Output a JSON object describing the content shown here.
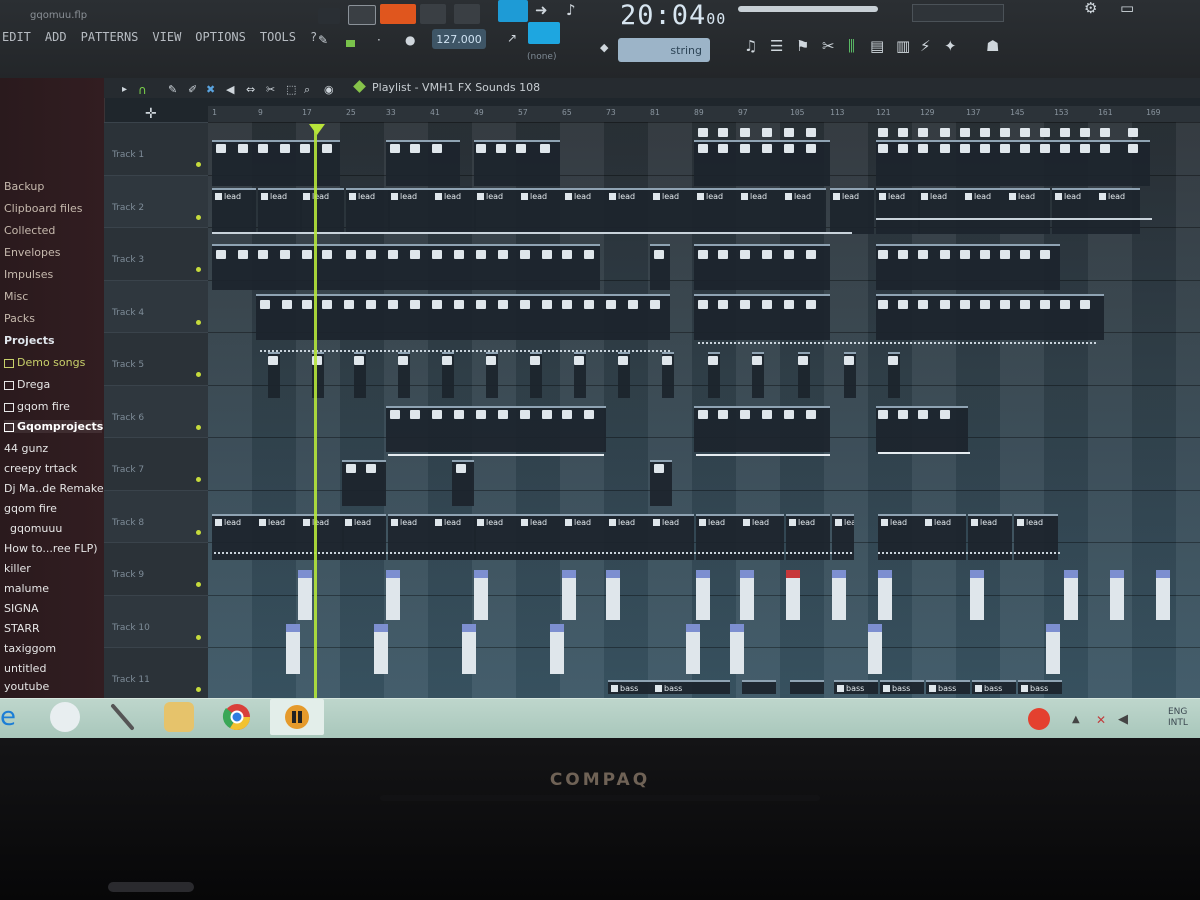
{
  "app": {
    "title": "gqomuu.flp",
    "menu": [
      "EDIT",
      "ADD",
      "PATTERNS",
      "VIEW",
      "OPTIONS",
      "TOOLS",
      "?"
    ],
    "clock": "20:04",
    "clock_sub": "00",
    "tempo": "127.000",
    "snap": "(none)",
    "pattern_selector": "string"
  },
  "browser": {
    "items": [
      {
        "label": "Backup",
        "kind": "sect"
      },
      {
        "label": "Clipboard files",
        "kind": "sect"
      },
      {
        "label": "Collected",
        "kind": "sect"
      },
      {
        "label": "Envelopes",
        "kind": "sect"
      },
      {
        "label": "Impulses",
        "kind": "sect"
      },
      {
        "label": "Misc",
        "kind": "sect"
      },
      {
        "label": "Packs",
        "kind": "sect"
      },
      {
        "label": "Projects",
        "kind": "proj"
      },
      {
        "label": "Demo songs",
        "kind": "folder"
      },
      {
        "label": "Drega",
        "kind": "file"
      },
      {
        "label": "gqom fire",
        "kind": "file"
      },
      {
        "label": "Gqomprojects",
        "kind": "selected"
      },
      {
        "label": "44 gunz",
        "kind": "file"
      },
      {
        "label": "creepy trtack",
        "kind": "file"
      },
      {
        "label": "Dj Ma..de Remake",
        "kind": "file"
      },
      {
        "label": "gqom fire",
        "kind": "file"
      },
      {
        "label": "gqomuuu",
        "kind": "file"
      },
      {
        "label": "How to...ree FLP)",
        "kind": "file"
      },
      {
        "label": "killer",
        "kind": "file"
      },
      {
        "label": "malume",
        "kind": "file"
      },
      {
        "label": "SIGNA",
        "kind": "file"
      },
      {
        "label": "STARR",
        "kind": "file"
      },
      {
        "label": "taxiggom",
        "kind": "file"
      },
      {
        "label": "untitled",
        "kind": "file"
      },
      {
        "label": "youtube",
        "kind": "file"
      }
    ]
  },
  "playlist": {
    "title": "Playlist - VMH1 FX Sounds 108",
    "ruler": [
      "1",
      "9",
      "17",
      "25",
      "33",
      "41",
      "49",
      "57",
      "65",
      "73",
      "81",
      "89",
      "97",
      "105",
      "113",
      "121",
      "129",
      "137",
      "145",
      "153",
      "161",
      "169"
    ],
    "tracks": [
      "Track 1",
      "Track 2",
      "Track 3",
      "Track 4",
      "Track 5",
      "Track 6",
      "Track 7",
      "Track 8",
      "Track 9",
      "Track 10",
      "Track 11"
    ],
    "clip_labels": {
      "lead": "lead",
      "bass": "bass"
    }
  },
  "taskbar": {
    "lang": "ENG",
    "lang_sub": "INTL"
  },
  "bezel": {
    "brand": "COMPAQ"
  }
}
